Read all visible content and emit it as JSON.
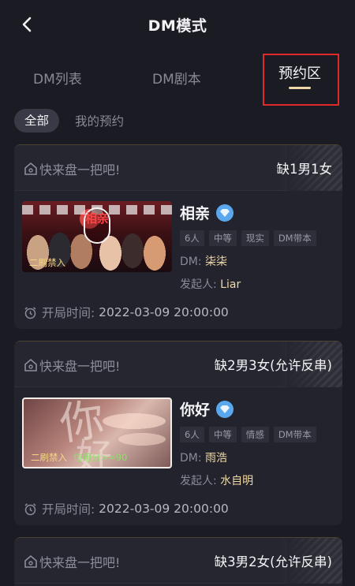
{
  "header": {
    "title": "DM模式"
  },
  "tabs": [
    {
      "label": "DM列表"
    },
    {
      "label": "DM剧本"
    },
    {
      "label": "预约区"
    }
  ],
  "subtabs": {
    "all": "全部",
    "mine": "我的预约"
  },
  "labels": {
    "dm": "DM: ",
    "initiator": "发起人: ",
    "start_time": "开局时间: "
  },
  "cards": [
    {
      "invite": "快来盘一把吧!",
      "need": "缺1男1女",
      "name": "相亲",
      "cover_tag": "二刷禁入",
      "cover_logo": "相亲",
      "tags": [
        "6人",
        "中等",
        "现实",
        "DM带本"
      ],
      "dm": "柒柒",
      "initiator": "Liar",
      "start_time": "2022-03-09 20:00:00"
    },
    {
      "invite": "快来盘一把吧!",
      "need": "缺2男3女(允许反串)",
      "name": "你好",
      "cover_tag": "二刷禁入",
      "cover_score": "信用分>=90",
      "cover_calli_1": "你",
      "cover_calli_2": "好",
      "tags": [
        "6人",
        "中等",
        "情感",
        "DM带本"
      ],
      "dm": "雨浩",
      "initiator": "水自明",
      "start_time": "2022-03-09 20:00:00"
    },
    {
      "invite": "快来盘一把吧!",
      "need": "缺3男2女(允许反串)"
    }
  ],
  "icons": {
    "back": "chevron-left-icon",
    "invite": "home-icon",
    "vip": "diamond-icon",
    "clock": "alarm-clock-icon"
  },
  "colors": {
    "background": "#1b1b24",
    "card": "#23232d",
    "accent_gold": "#f0d9a8",
    "highlight_border": "#e02a2a",
    "vip_blue": "#5aa7ee"
  }
}
